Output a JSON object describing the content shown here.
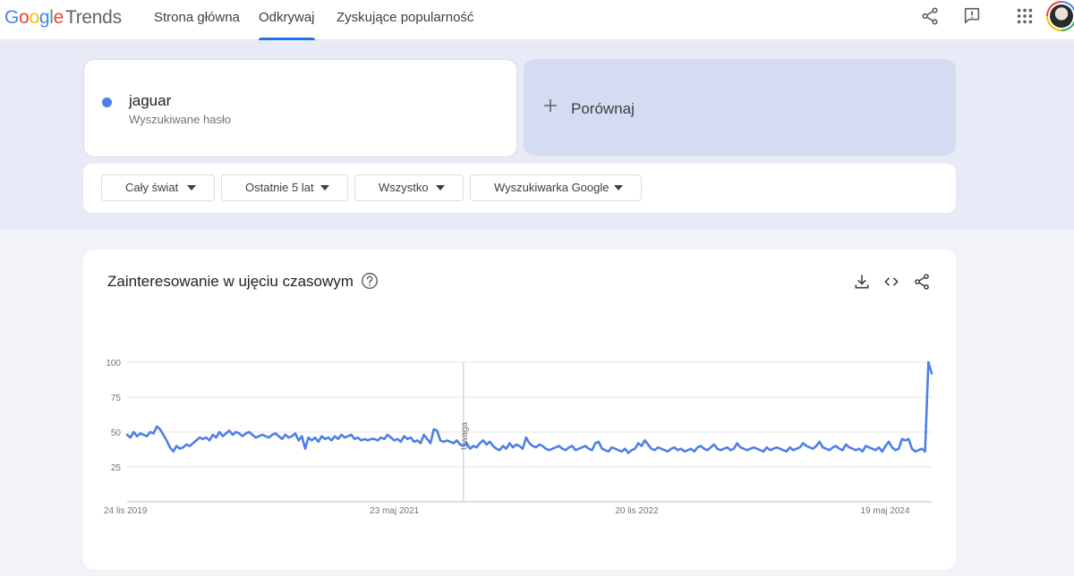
{
  "header": {
    "logo_google": "Google",
    "logo_trends": "Trends",
    "tabs": [
      {
        "label": "Strona główna"
      },
      {
        "label": "Odkrywaj"
      },
      {
        "label": "Zyskujące popularność"
      }
    ],
    "active_tab": "Odkrywaj",
    "icons": [
      "share-icon",
      "feedback-icon",
      "apps-grid-icon",
      "avatar"
    ]
  },
  "search": {
    "term": "jaguar",
    "term_type": "Wyszukiwane hasło",
    "term_color": "#4f7fe6",
    "compare_label": "Porównaj"
  },
  "filters": {
    "region": "Cały świat",
    "period": "Ostatnie 5 lat",
    "category": "Wszystko",
    "source": "Wyszukiwarka Google"
  },
  "chart_card": {
    "title": "Zainteresowanie w ujęciu czasowym",
    "icons": [
      "help-icon",
      "download-icon",
      "embed-icon",
      "share-icon"
    ]
  },
  "chart_data": {
    "type": "line",
    "series": [
      {
        "name": "jaguar",
        "color": "#4f7fe6"
      }
    ],
    "ylim": [
      0,
      100
    ],
    "y_ticks": [
      "100",
      "75",
      "50",
      "25"
    ],
    "x_tick_labels": [
      "24 lis 2019",
      "23 maj 2021",
      "20 lis 2022",
      "19 maj 2024"
    ],
    "annotation": {
      "label": "Uwaga",
      "date": "2021-12"
    },
    "values": [
      48,
      46,
      50,
      47,
      49,
      48,
      47,
      50,
      49,
      54,
      52,
      48,
      44,
      39,
      36,
      40,
      38,
      39,
      41,
      40,
      42,
      44,
      46,
      45,
      46,
      44,
      48,
      46,
      50,
      47,
      49,
      51,
      48,
      50,
      49,
      47,
      49,
      50,
      48,
      46,
      47,
      48,
      47,
      46,
      48,
      49,
      47,
      45,
      48,
      46,
      47,
      49,
      44,
      47,
      38,
      46,
      44,
      46,
      43,
      47,
      45,
      46,
      44,
      47,
      45,
      48,
      46,
      47,
      48,
      45,
      46,
      44,
      45,
      44,
      45,
      45,
      44,
      46,
      45,
      48,
      46,
      44,
      45,
      43,
      47,
      45,
      46,
      43,
      44,
      42,
      48,
      45,
      42,
      52,
      51,
      44,
      43,
      44,
      43,
      42,
      44,
      41,
      40,
      42,
      38,
      40,
      39,
      42,
      44,
      41,
      43,
      40,
      38,
      37,
      40,
      38,
      42,
      39,
      41,
      40,
      38,
      46,
      42,
      40,
      39,
      41,
      40,
      38,
      37,
      38,
      39,
      40,
      38,
      37,
      39,
      40,
      37,
      38,
      39,
      40,
      38,
      37,
      42,
      43,
      38,
      37,
      36,
      39,
      38,
      37,
      36,
      38,
      35,
      37,
      38,
      42,
      40,
      44,
      41,
      38,
      37,
      39,
      38,
      37,
      36,
      38,
      39,
      37,
      38,
      36,
      37,
      38,
      36,
      39,
      40,
      38,
      37,
      39,
      41,
      38,
      37,
      38,
      39,
      37,
      38,
      42,
      39,
      38,
      37,
      38,
      39,
      38,
      37,
      36,
      39,
      37,
      38,
      39,
      38,
      37,
      36,
      39,
      37,
      38,
      39,
      42,
      40,
      39,
      38,
      40,
      43,
      39,
      38,
      37,
      39,
      40,
      38,
      37,
      41,
      39,
      38,
      37,
      38,
      36,
      40,
      39,
      38,
      37,
      39,
      36,
      40,
      43,
      39,
      37,
      38,
      45,
      44,
      45,
      38,
      36,
      37,
      38,
      36,
      100,
      92
    ]
  }
}
